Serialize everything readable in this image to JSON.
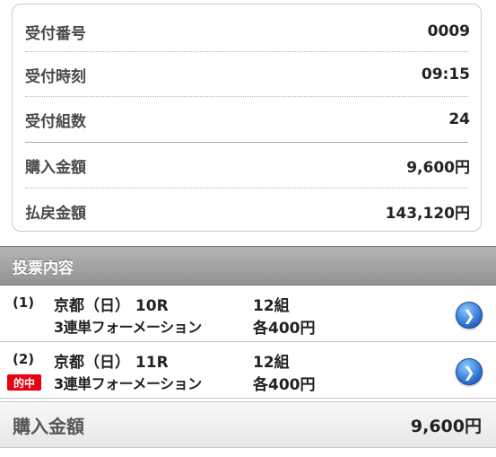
{
  "summary": {
    "rows": [
      {
        "label": "受付番号",
        "value": "0009"
      },
      {
        "label": "受付時刻",
        "value": "09:15"
      },
      {
        "label": "受付組数",
        "value": "24"
      },
      {
        "label": "購入金額",
        "value": "9,600円"
      },
      {
        "label": "払戻金額",
        "value": "143,120円"
      }
    ]
  },
  "bets": {
    "header": "投票内容",
    "items": [
      {
        "num": "(1)",
        "race": "京都（日）  10R",
        "type": "3連単フォーメーション",
        "sets": "12組",
        "each": "各400円",
        "badge": ""
      },
      {
        "num": "(2)",
        "race": "京都（日）  11R",
        "type": "3連単フォーメーション",
        "sets": "12組",
        "each": "各400円",
        "badge": "的中"
      }
    ]
  },
  "total": {
    "label": "購入金額",
    "value": "9,600円"
  },
  "icons": {
    "detail": "chevron-right-icon",
    "badge_color": "#e60012"
  }
}
